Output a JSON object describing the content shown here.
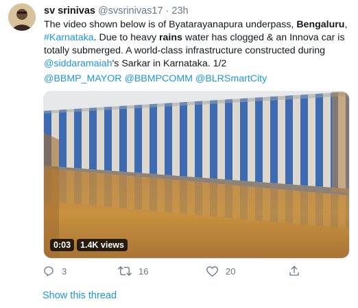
{
  "tweet": {
    "author_name": "sv srinivas",
    "author_handle": "@svsrinivas17",
    "separator": "·",
    "time": "23h",
    "text": {
      "t1": "The video shown below is of Byatarayanapura underpass, ",
      "t2": "Bengaluru",
      "t3": ",",
      "hashtag": "#Karnataka",
      "t4": ". Due to heavy ",
      "t5": "rains",
      "t6": " water has clogged & an Innova car is totally submerged. A world-class infrastructure constructed during ",
      "mention": "@siddaramaiah",
      "t7": "'s Sarkar in Karnataka. 1/2"
    },
    "mentions": [
      "@BBMP_MAYOR",
      "@BBMPCOMM",
      "@BLRSmartCity"
    ],
    "video": {
      "duration": "0:03",
      "views": "1.4K views"
    },
    "actions": {
      "replies": "3",
      "retweets": "16",
      "likes": "20"
    },
    "show_thread": "Show this thread"
  },
  "icons": {
    "reply": "reply-icon",
    "retweet": "retweet-icon",
    "like": "heart-icon",
    "share": "share-icon",
    "more": "more-icon"
  },
  "colors": {
    "link": "#1b95e0",
    "muted": "#657786",
    "wall_blue": "#3f6fb3",
    "water": "#c98e3e"
  }
}
